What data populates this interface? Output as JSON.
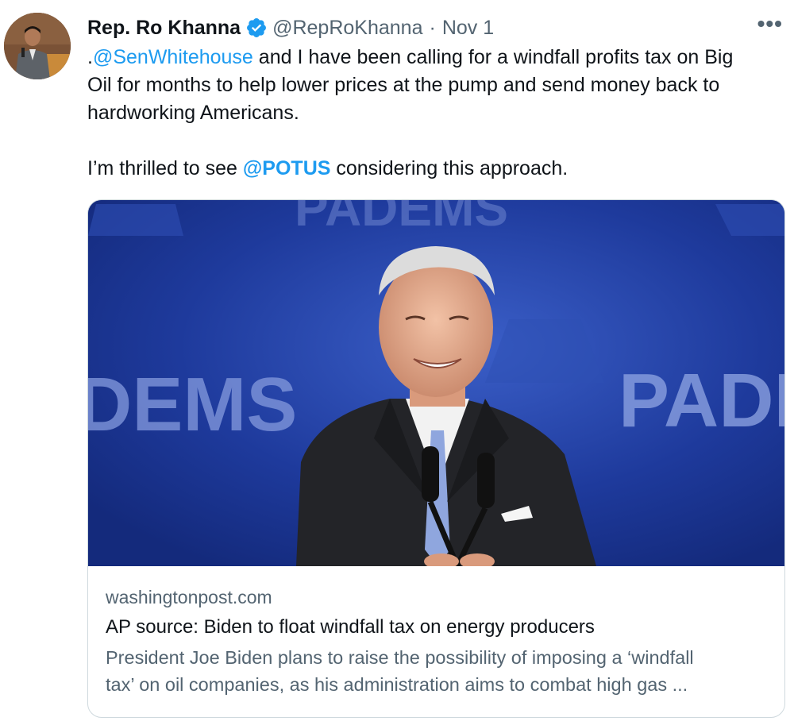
{
  "tweet": {
    "author_name": "Rep. Ro Khanna",
    "author_handle": "@RepRoKhanna",
    "separator": "·",
    "date": "Nov 1",
    "more_label": "•••",
    "text": {
      "line1_prefix": ".",
      "line1_mention": "@SenWhitehouse",
      "line1_rest": " and I have been calling for a windfall profits tax on Big",
      "line2": "Oil for months to help lower prices at the pump and send money back to",
      "line3": "hardworking Americans.",
      "line4_prefix": "I’m thrilled to see ",
      "line4_mention": "@POTUS",
      "line4_rest": " considering this approach."
    }
  },
  "card": {
    "domain": "washingtonpost.com",
    "title": "AP source: Biden to float windfall tax on energy producers",
    "description_line1": "President Joe Biden plans to raise the possibility of imposing a ‘windfall",
    "description_line2": "tax’ on oil companies, as his administration aims to combat high gas ...",
    "image_backdrop_left": "DEMS",
    "image_backdrop_right": "PADI",
    "image_backdrop_top": "PADEMS"
  },
  "colors": {
    "link": "#1d9bf0",
    "secondary_text": "#536471",
    "verified_badge": "#1d9bf0",
    "card_border": "#cfd9de",
    "image_background": "#1f3a9a"
  },
  "icons": {
    "verified": "verified-badge-icon",
    "more": "more-options-icon"
  }
}
